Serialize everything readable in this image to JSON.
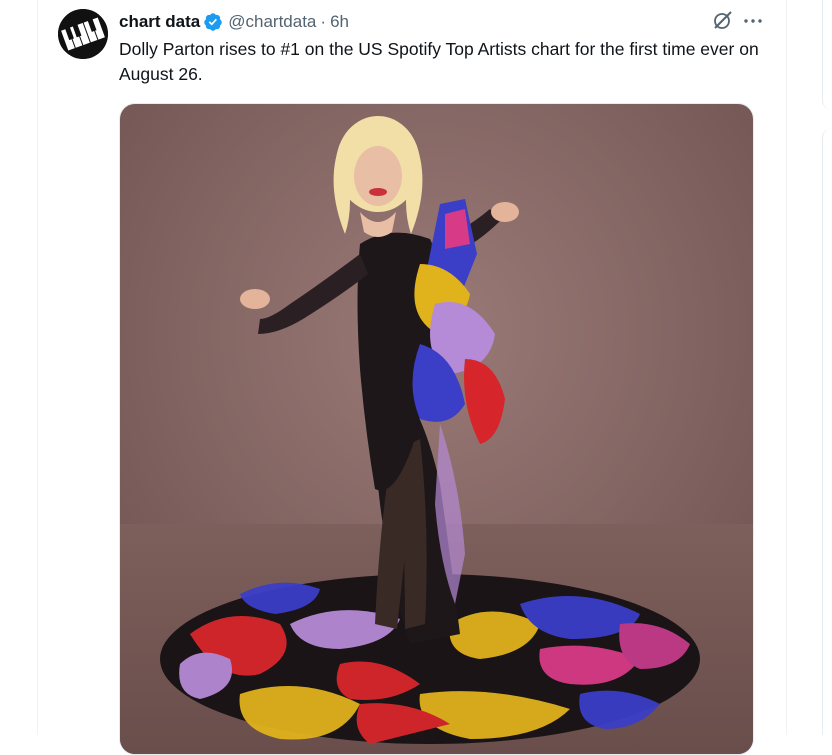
{
  "tweet": {
    "display_name": "chart data",
    "handle": "@chartdata",
    "separator": "·",
    "time": "6h",
    "text": "Dolly Parton rises to #1 on the US Spotify Top Artists chart for the first time ever on August 26."
  },
  "icons": {
    "avatar": "piano-keys-avatar-icon",
    "verified": "verified-badge-icon",
    "grok": "grok-icon",
    "more": "more-options-icon"
  },
  "colors": {
    "verified_blue": "#1d9bf0",
    "text_primary": "#0f1419",
    "text_secondary": "#536471",
    "photo_backdrop": "#8e6e6b"
  }
}
